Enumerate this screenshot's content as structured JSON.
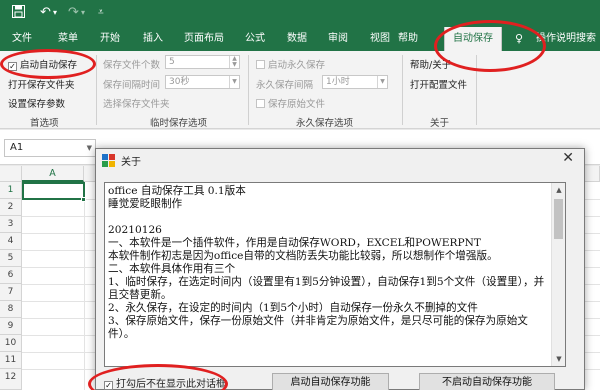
{
  "titlebar": {
    "save_icon": "save-icon",
    "undo_icon": "undo-icon",
    "redo_icon": "redo-icon",
    "customize_icon": "customize-icon"
  },
  "tabs": [
    "文件",
    "菜单",
    "开始",
    "插入",
    "页面布局",
    "公式",
    "数据",
    "审阅",
    "视图",
    "帮助",
    "自动保存",
    "操作说明搜索"
  ],
  "active_tab": "自动保存",
  "ribbon": {
    "group_common": {
      "enable_autosave": "启动自动保存",
      "enable_autosave_checked": true,
      "open_save_folder": "打开保存文件夹",
      "set_save_params": "设置保存参数",
      "label": "首选项"
    },
    "group_temp": {
      "file_count_label": "保存文件个数",
      "file_count_value": "5",
      "interval_label": "保存间隔时间",
      "interval_value": "30秒",
      "choose_folder": "选择保存文件夹",
      "label": "临时保存选项"
    },
    "group_perm": {
      "enable_permanent": "启动永久保存",
      "interval_label": "永久保存间隔",
      "interval_value": "1小时",
      "save_original": "保存原始文件",
      "label": "永久保存选项"
    },
    "group_about": {
      "help_about": "帮助/关于",
      "open_config": "打开配置文件",
      "label": "关于"
    }
  },
  "formula_bar": {
    "cell_ref": "A1"
  },
  "grid": {
    "columns": [
      "A"
    ],
    "rows": [
      "1",
      "2",
      "3",
      "4",
      "5",
      "6",
      "7",
      "8",
      "9",
      "10",
      "11",
      "12"
    ]
  },
  "dialog": {
    "title": "关于",
    "close": "✕",
    "text": "office 自动保存工具 0.1版本\n睡觉爱眨眼制作\n\n20210126\n一、本软件是一个插件软件，作用是自动保存WORD，EXCEL和POWERPNT\n本软件制作初志是因为office自带的文档防丢失功能比较弱，所以想制作个增强版。\n二、本软件具体作用有三个\n1、临时保存，在选定时间内（设置里有1到5分钟设置），自动保存1到5个文件（设置里），并且交替更新。\n2、永久保存，在设定的时间内（1到5个小时）自动保存一份永久不删掉的文件\n3、保存原始文件，保存一份原始文件（并非肯定为原始文件，是只尽可能的保存为原始文件）。",
    "checkbox_label": "打勾后不在显示此对话框",
    "checkbox_checked": true,
    "btn_enable": "启动自动保存功能",
    "btn_disable": "不启动自动保存功能"
  },
  "colors": {
    "excel_green": "#217346",
    "annotation_red": "#e02020"
  }
}
